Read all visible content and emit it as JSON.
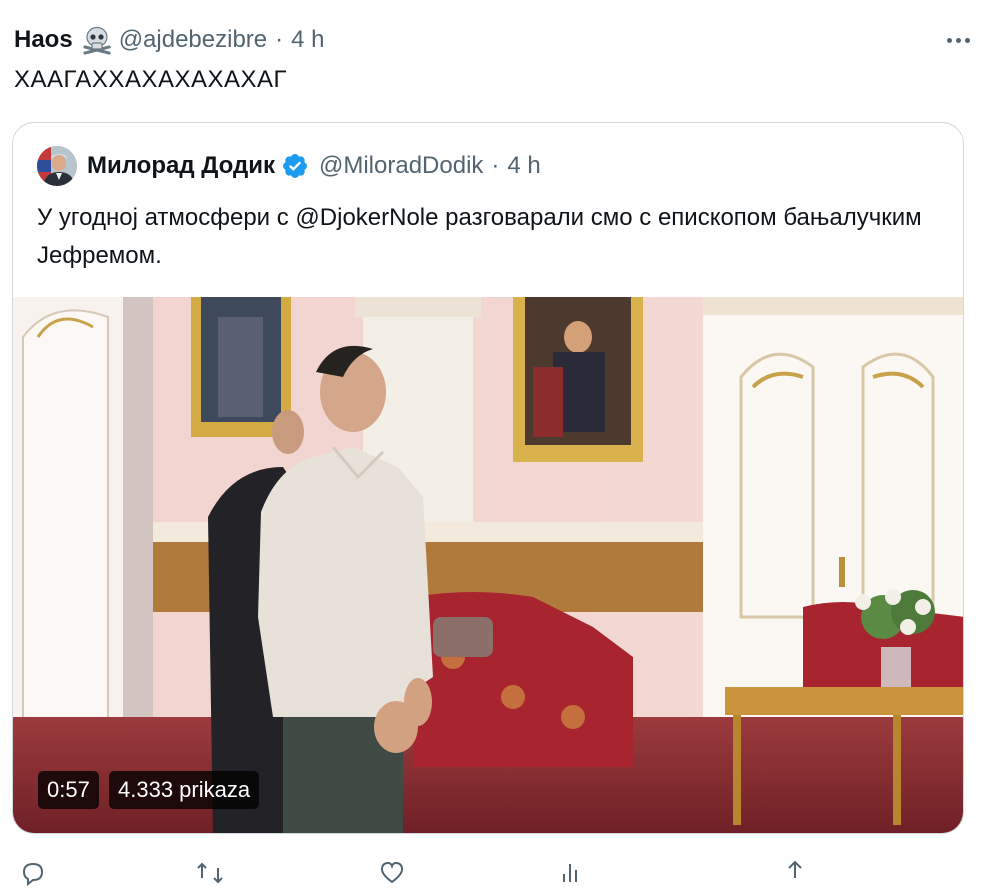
{
  "tweet": {
    "author_name": "Haos",
    "author_emoji_icon": "skull-crossbones-icon",
    "handle": "@ajdebezibre",
    "separator": "·",
    "time": "4 h",
    "text": "ХААГАХХАХАХАХАХАГ"
  },
  "quoted": {
    "author_name": "Милорад Додик",
    "verified": true,
    "handle": "@MiloradDodik",
    "separator": "·",
    "time": "4 h",
    "text": "У угодној атмосфери с @DjokerNole разговарали смо с епископом бањалучким Јефремом.",
    "video": {
      "duration": "0:57",
      "views": "4.333 prikaza"
    }
  },
  "colors": {
    "text": "#0f1419",
    "secondary": "#536471",
    "border": "#cfd9de",
    "verified": "#1d9bf0"
  },
  "actions": [
    "reply-icon",
    "retweet-icon",
    "like-icon",
    "views-icon",
    "share-icon"
  ]
}
